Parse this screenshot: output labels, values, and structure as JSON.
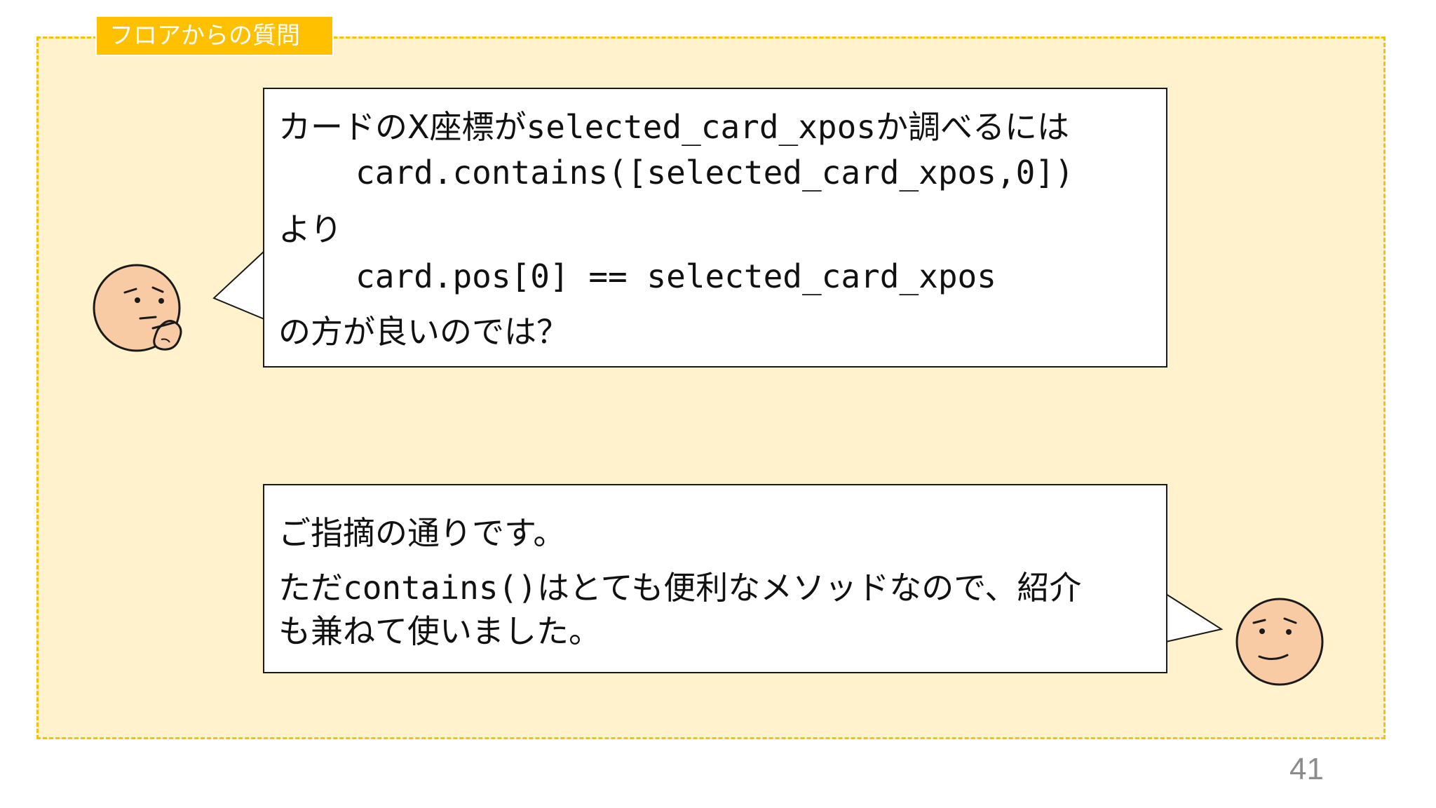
{
  "section_label": "フロアからの質問",
  "question": {
    "line1_pre": "カードのX座標が",
    "line1_code": "selected_card_xpos",
    "line1_post": "か調べるには",
    "code1": "card.contains([selected_card_xpos,0])",
    "line3": "より",
    "code2": "card.pos[0] == selected_card_xpos",
    "line5": "の方が良いのでは？"
  },
  "answer": {
    "line1": "ご指摘の通りです。",
    "line2_pre": "ただ",
    "line2_code": "contains()",
    "line2_post": "はとても便利なメソッドなので、紹介",
    "line3": "も兼ねて使いました。"
  },
  "page_number": "41",
  "colors": {
    "frame_fill": "#fff2cc",
    "frame_border": "#f4c20d",
    "label_fill": "#ffc000",
    "face_fill": "#f8cba5"
  },
  "icons": {
    "asker": "thinking-face-icon",
    "answerer": "smiling-face-icon"
  }
}
